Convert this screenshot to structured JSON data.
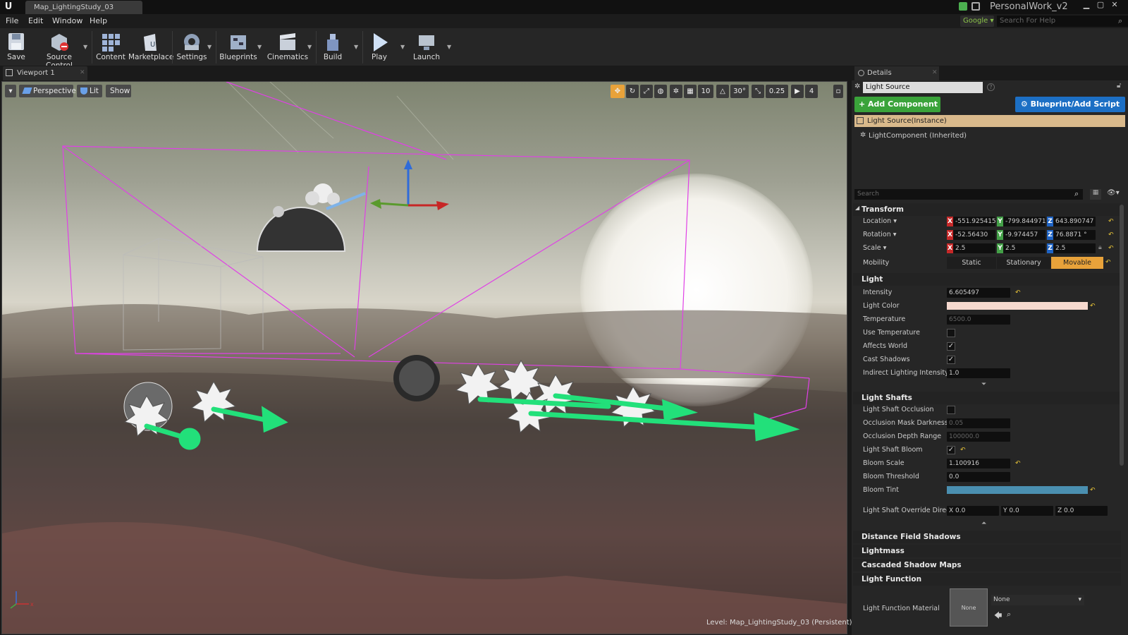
{
  "titlebar": {
    "tab": "Map_LightingStudy_03",
    "project": "PersonalWork_v2",
    "logo": "U"
  },
  "menu": [
    "File",
    "Edit",
    "Window",
    "Help"
  ],
  "help": {
    "engine": "Google",
    "placeholder": "Search For Help"
  },
  "toolbar": [
    {
      "label": "Save",
      "icon": "save-icon"
    },
    {
      "label": "Source Control",
      "icon": "source-control-icon"
    },
    {
      "label": "Content",
      "icon": "content-icon"
    },
    {
      "label": "Marketplace",
      "icon": "marketplace-icon"
    },
    {
      "label": "Settings",
      "icon": "settings-icon"
    },
    {
      "label": "Blueprints",
      "icon": "blueprints-icon"
    },
    {
      "label": "Cinematics",
      "icon": "cinematics-icon"
    },
    {
      "label": "Build",
      "icon": "build-icon"
    },
    {
      "label": "Play",
      "icon": "play-icon"
    },
    {
      "label": "Launch",
      "icon": "launch-icon"
    }
  ],
  "viewport": {
    "tab": "Viewport 1",
    "perspective": "Perspective",
    "lit": "Lit",
    "show": "Show",
    "grid_snap": "10",
    "rot_snap": "30°",
    "scale_snap": "0.25",
    "cam_speed": "4",
    "level": "Level:  Map_LightingStudy_03 (Persistent)"
  },
  "details": {
    "tab": "Details",
    "name": "Light Source",
    "add_component": "+ Add Component ▾",
    "blueprint": "Blueprint/Add Script",
    "component": "Light Source(Instance)",
    "child": "LightComponent (Inherited)",
    "search_placeholder": "Search",
    "transform": {
      "title": "Transform",
      "location": {
        "label": "Location ▾",
        "x": "-551.925415",
        "y": "-799.844971",
        "z": "643.890747"
      },
      "rotation": {
        "label": "Rotation ▾",
        "x": "-52.56430",
        "y": "-9.974457",
        "z": "76.8871 °"
      },
      "scale": {
        "label": "Scale ▾",
        "x": "2.5",
        "y": "2.5",
        "z": "2.5"
      },
      "mobility": {
        "label": "Mobility",
        "static": "Static",
        "stationary": "Stationary",
        "movable": "Movable"
      }
    },
    "light": {
      "title": "Light",
      "intensity": {
        "label": "Intensity",
        "value": "6.605497"
      },
      "color": {
        "label": "Light Color",
        "hex": "#f6d9cf"
      },
      "temperature": {
        "label": "Temperature",
        "value": "6500.0"
      },
      "use_temp": {
        "label": "Use Temperature",
        "checked": ""
      },
      "affects": {
        "label": "Affects World",
        "checked": "✓"
      },
      "cast": {
        "label": "Cast Shadows",
        "checked": "✓"
      },
      "indirect": {
        "label": "Indirect Lighting Intensity",
        "value": "1.0"
      }
    },
    "shafts": {
      "title": "Light Shafts",
      "occlusion": {
        "label": "Light Shaft Occlusion",
        "checked": ""
      },
      "mask": {
        "label": "Occlusion Mask Darkness",
        "value": "0.05"
      },
      "depth": {
        "label": "Occlusion Depth Range",
        "value": "100000.0"
      },
      "bloom": {
        "label": "Light Shaft Bloom",
        "checked": "✓"
      },
      "bloom_scale": {
        "label": "Bloom Scale",
        "value": "1.100916"
      },
      "bloom_thresh": {
        "label": "Bloom Threshold",
        "value": "0.0"
      },
      "bloom_tint": {
        "label": "Bloom Tint",
        "hex": "#4a8fb0"
      },
      "override": {
        "label": "Light Shaft Override Directio",
        "x": "0.0",
        "y": "0.0",
        "z": "0.0"
      }
    },
    "collapsed": [
      "Distance Field Shadows",
      "Lightmass",
      "Cascaded Shadow Maps"
    ],
    "function": {
      "title": "Light Function",
      "material_label": "Light Function Material",
      "thumb": "None",
      "value": "None"
    },
    "axis": {
      "x": "X",
      "y": "Y",
      "z": "Z"
    }
  }
}
